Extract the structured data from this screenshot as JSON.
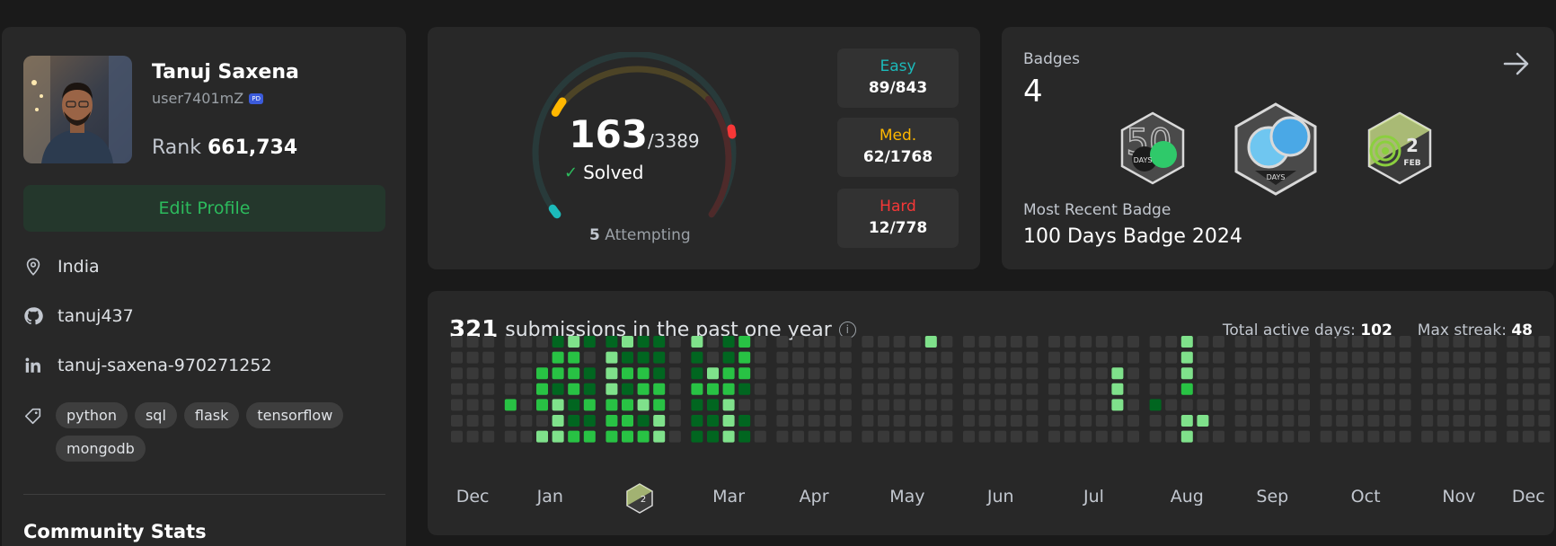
{
  "profile": {
    "name": "Tanuj Saxena",
    "username": "user7401mZ",
    "verified_badge": "PD",
    "rank_label": "Rank",
    "rank_value": "661,734",
    "edit_button": "Edit Profile",
    "location": "India",
    "github": "tanuj437",
    "linkedin": "tanuj-saxena-970271252",
    "skills": [
      "python",
      "sql",
      "flask",
      "tensorflow",
      "mongodb"
    ],
    "community_title": "Community Stats",
    "icons": [
      "location-pin-icon",
      "github-icon",
      "linkedin-icon",
      "tag-icon"
    ]
  },
  "solved": {
    "solved_count": "163",
    "total": "/3389",
    "label": "Solved",
    "attempting_count": "5",
    "attempting_label": "Attempting",
    "difficulties": [
      {
        "label": "Easy",
        "value": "89/843",
        "color": "#1cbaba"
      },
      {
        "label": "Med.",
        "value": "62/1768",
        "color": "#ffb700"
      },
      {
        "label": "Hard",
        "value": "12/778",
        "color": "#f63737"
      }
    ]
  },
  "badges": {
    "title": "Badges",
    "count": "4",
    "items": [
      {
        "name": "50-days-badge-icon",
        "text": "DAYS",
        "number": "50"
      },
      {
        "name": "100-days-badge-icon",
        "text": "DAYS"
      },
      {
        "name": "feb-2-badge-icon",
        "text": "FEB",
        "number": "2"
      }
    ],
    "recent_label": "Most Recent Badge",
    "recent_name": "100 Days Badge 2024"
  },
  "heatmap": {
    "count": "321",
    "title_text": "submissions in the past one year",
    "active_label": "Total active days:",
    "active_value": "102",
    "streak_label": "Max streak:",
    "streak_value": "48",
    "months": [
      "Dec",
      "Jan",
      "Feb",
      "Mar",
      "Apr",
      "May",
      "Jun",
      "Jul",
      "Aug",
      "Sep",
      "Oct",
      "Nov",
      "Dec"
    ],
    "palette": {
      "0": "#393939",
      "1": "#016620",
      "2": "#28c244",
      "3": "#7fe18b"
    },
    "calendar_badge": {
      "text": "2"
    },
    "month_data": [
      [
        "0000000",
        "0000000",
        "0000000"
      ],
      [
        "0000200",
        "0000000",
        "0022203",
        "1221333",
        "3222112",
        "1011212"
      ],
      [
        "1333222",
        "3121222",
        "1122312",
        "1112233",
        "0000000"
      ],
      [
        "3112111",
        "0032111",
        "1122333",
        "2221011",
        "0000000"
      ],
      [
        "0000000",
        "0000000",
        "0000000",
        "0000000",
        "0000000"
      ],
      [
        "0000000",
        "0000000",
        "0000000",
        "0000000",
        "3000000",
        "0000000"
      ],
      [
        "0000000",
        "0000000",
        "0000000",
        "0000000",
        "0000000"
      ],
      [
        "0000000",
        "0000000",
        "0000000",
        "0000000",
        "0033300",
        "0000000"
      ],
      [
        "0000100",
        "0000000",
        "3332033",
        "0000030",
        "0000000"
      ],
      [
        "0000000",
        "0000000",
        "0000000",
        "0000000",
        "0000000"
      ],
      [
        "0000000",
        "0000000",
        "0000000",
        "0000000",
        "0000000",
        "0000000"
      ],
      [
        "0000000",
        "0000000",
        "0000000",
        "0000000",
        "0000000"
      ],
      [
        "0000000",
        "0000000",
        "0000000"
      ]
    ]
  }
}
